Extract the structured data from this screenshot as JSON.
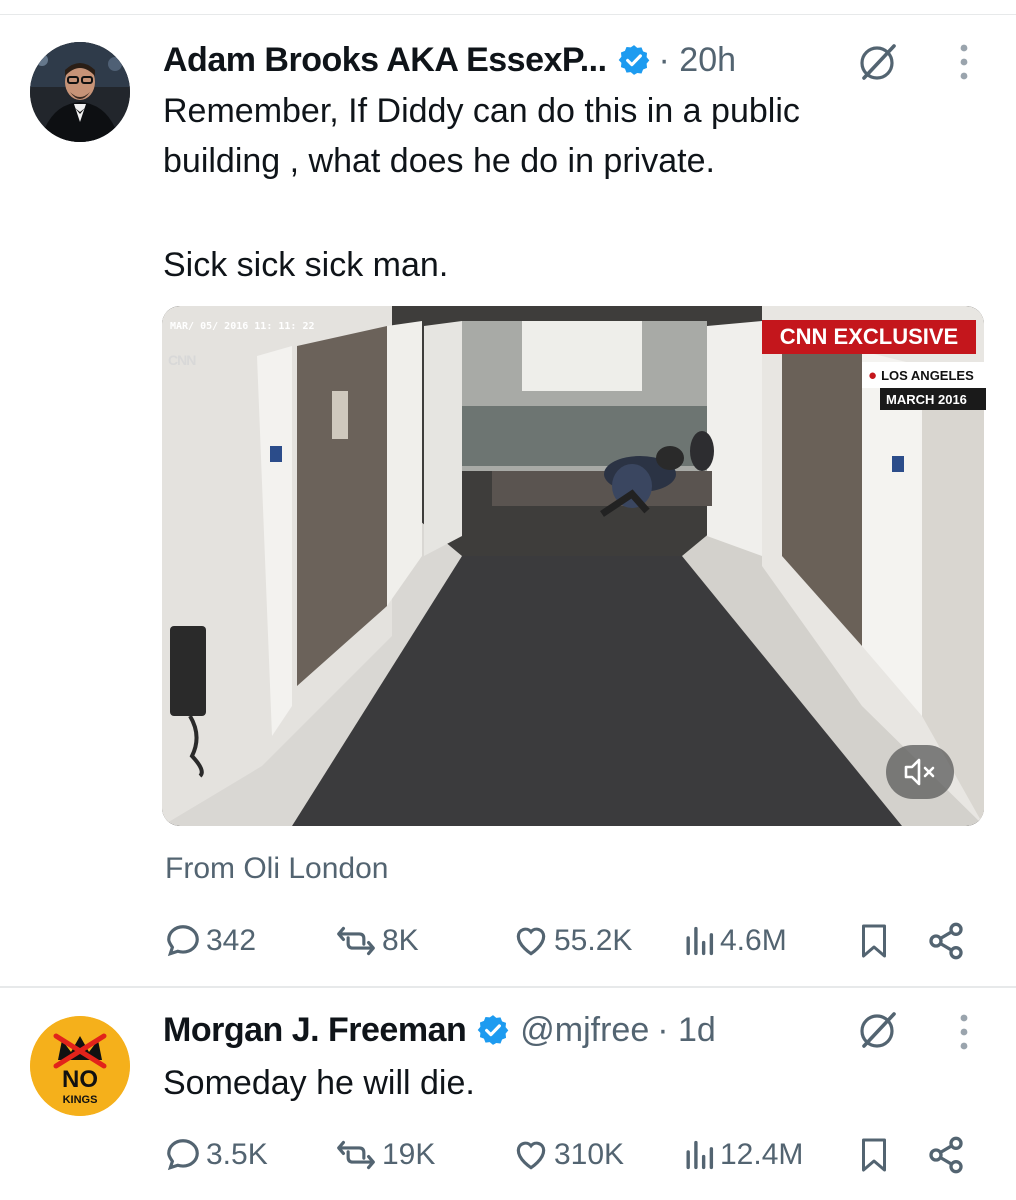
{
  "tweets": [
    {
      "author": "Adam Brooks AKA EssexP...",
      "handle": "",
      "time": "· 20h",
      "text_lines": [
        "Remember, If Diddy can do this in a public",
        "building , what does he do in private."
      ],
      "text_extra": "Sick sick sick man.",
      "media": {
        "timestamp": "MAR/ 05/ 2016 11: 11: 22",
        "watermark": "CNN",
        "banner": "CNN EXCLUSIVE",
        "location": "LOS ANGELES",
        "date": "MARCH 2016"
      },
      "attribution": "From Oli London",
      "stats": {
        "replies": "342",
        "reposts": "8K",
        "likes": "55.2K",
        "views": "4.6M"
      }
    },
    {
      "author": "Morgan J. Freeman",
      "handle": "@mjfree",
      "time": "· 1d",
      "text": "Someday he will die.",
      "avatar_text": "NO",
      "avatar_subtext": "KINGS",
      "stats": {
        "replies": "3.5K",
        "reposts": "19K",
        "likes": "310K",
        "views": "12.4M"
      }
    }
  ],
  "icons": {
    "verified": "verified-badge-icon",
    "grok": "grok-icon",
    "more": "more-icon",
    "reply": "reply-icon",
    "repost": "repost-icon",
    "like": "like-icon",
    "views": "views-icon",
    "bookmark": "bookmark-icon",
    "share": "share-icon",
    "mute": "mute-icon"
  },
  "colors": {
    "verified": "#1d9bf0",
    "muted_text": "#536471",
    "cnn_red": "#c4161c"
  }
}
